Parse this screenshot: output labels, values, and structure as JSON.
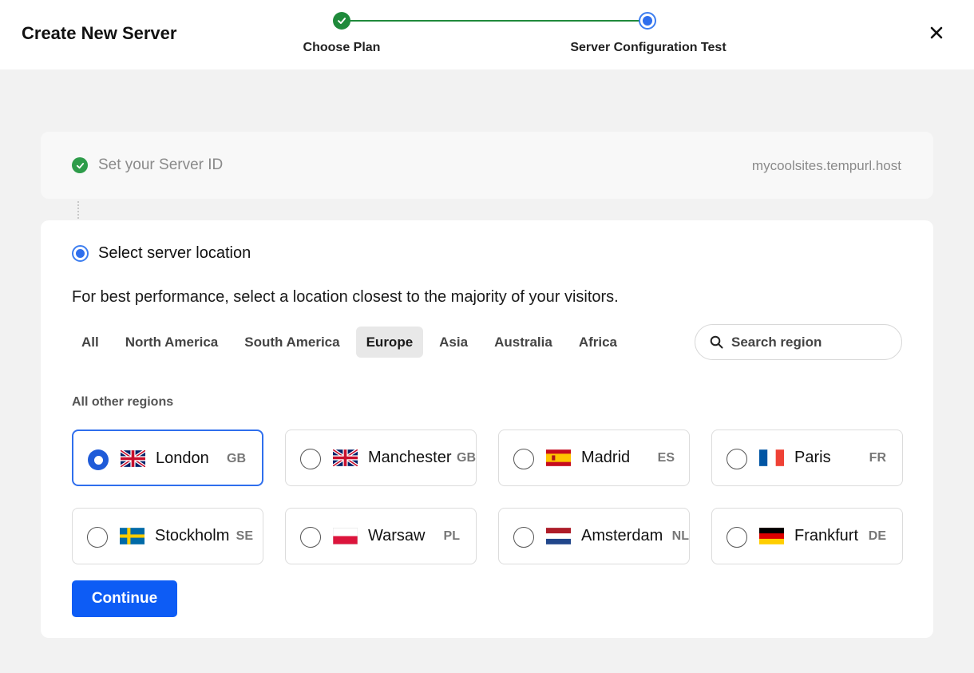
{
  "header": {
    "title": "Create New Server",
    "steps": [
      {
        "label": "Choose Plan",
        "status": "complete"
      },
      {
        "label": "Server Configuration Test",
        "status": "current"
      }
    ],
    "close_icon": "close-icon"
  },
  "server_id": {
    "label": "Set your Server ID",
    "value": "mycoolsites.tempurl.host",
    "status": "complete"
  },
  "location": {
    "title": "Select server location",
    "description": "For best performance, select a location closest to the majority of your visitors.",
    "tabs": [
      "All",
      "North America",
      "South America",
      "Europe",
      "Asia",
      "Australia",
      "Africa"
    ],
    "active_tab": "Europe",
    "search": {
      "placeholder": "Search region",
      "value": ""
    },
    "section_label": "All other regions",
    "items": [
      {
        "name": "London",
        "code": "GB",
        "flag": "uk-flag",
        "selected": true
      },
      {
        "name": "Manchester",
        "code": "GB",
        "flag": "uk-flag",
        "selected": false
      },
      {
        "name": "Madrid",
        "code": "ES",
        "flag": "spain-flag",
        "selected": false
      },
      {
        "name": "Paris",
        "code": "FR",
        "flag": "france-flag",
        "selected": false
      },
      {
        "name": "Stockholm",
        "code": "SE",
        "flag": "sweden-flag",
        "selected": false
      },
      {
        "name": "Warsaw",
        "code": "PL",
        "flag": "poland-flag",
        "selected": false
      },
      {
        "name": "Amsterdam",
        "code": "NL",
        "flag": "netherlands-flag",
        "selected": false
      },
      {
        "name": "Frankfurt",
        "code": "DE",
        "flag": "germany-flag",
        "selected": false
      }
    ],
    "continue_label": "Continue"
  },
  "colors": {
    "primary": "#0d5cf5",
    "accent_blue": "#2f6fed",
    "success_green": "#1f8a3b",
    "background": "#f2f2f2"
  }
}
